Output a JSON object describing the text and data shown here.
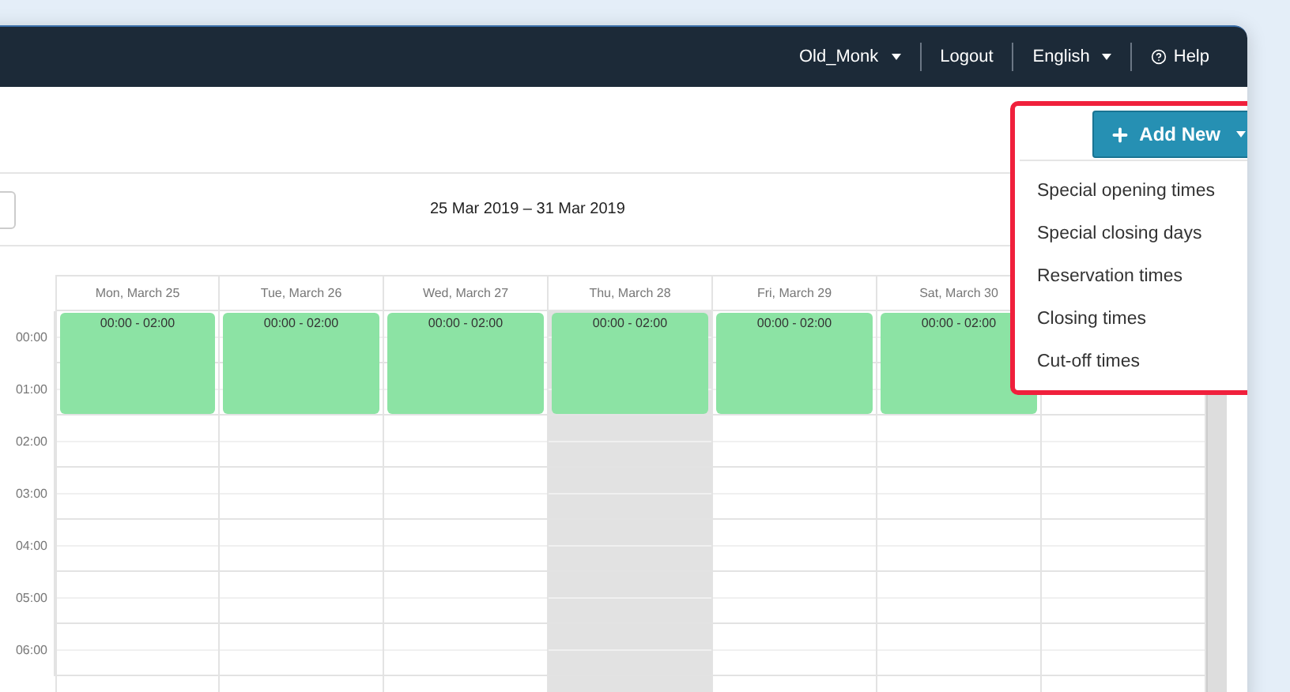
{
  "navbar": {
    "user": "Old_Monk",
    "logout": "Logout",
    "language": "English",
    "help": "Help"
  },
  "add_menu": {
    "button": "Add New",
    "expanded": true,
    "items": [
      {
        "label": "Special opening times"
      },
      {
        "label": "Special closing days"
      },
      {
        "label": "Reservation times"
      },
      {
        "label": "Closing times"
      },
      {
        "label": "Cut-off times"
      }
    ]
  },
  "date_range": "25 Mar 2019 – 31 Mar 2019",
  "calendar": {
    "days": [
      {
        "label": "Mon, March 25",
        "today": false,
        "event": "00:00 - 02:00"
      },
      {
        "label": "Tue, March 26",
        "today": false,
        "event": "00:00 - 02:00"
      },
      {
        "label": "Wed, March 27",
        "today": false,
        "event": "00:00 - 02:00"
      },
      {
        "label": "Thu, March 28",
        "today": true,
        "event": "00:00 - 02:00"
      },
      {
        "label": "Fri, March 29",
        "today": false,
        "event": "00:00 - 02:00"
      },
      {
        "label": "Sat, March 30",
        "today": false,
        "event": "00:00 - 02:00"
      }
    ],
    "hours": [
      "00:00",
      "01:00",
      "02:00",
      "03:00",
      "04:00",
      "05:00",
      "06:00"
    ]
  }
}
